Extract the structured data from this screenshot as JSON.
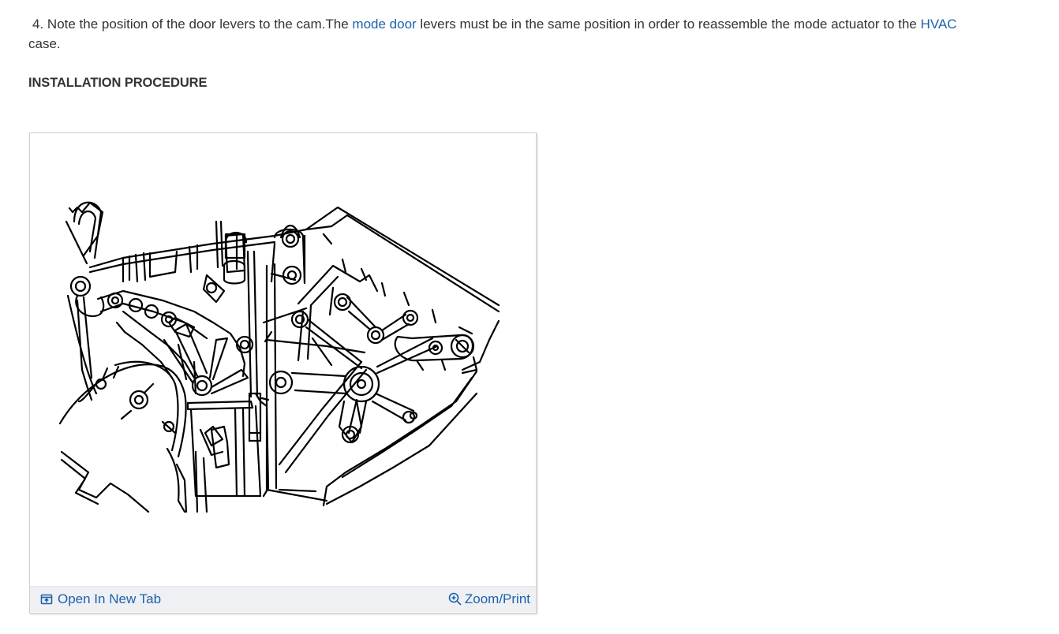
{
  "step": {
    "number": "4.",
    "text_before_link1": "Note the position of the door levers to the cam.The ",
    "link1": "mode door",
    "text_between_links": " levers must be in the same position in order to reassemble the mode actuator to the ",
    "link2": "HVAC",
    "text_after_link2": " case."
  },
  "heading": "INSTALLATION PROCEDURE",
  "figure": {
    "open_new_tab_label": "Open In New Tab",
    "zoom_print_label": "Zoom/Print",
    "icons": [
      "open-in-new-tab-icon",
      "zoom-in-icon"
    ],
    "link_color": "#1f62a8",
    "toolbar_bg": "#eef0f4"
  }
}
